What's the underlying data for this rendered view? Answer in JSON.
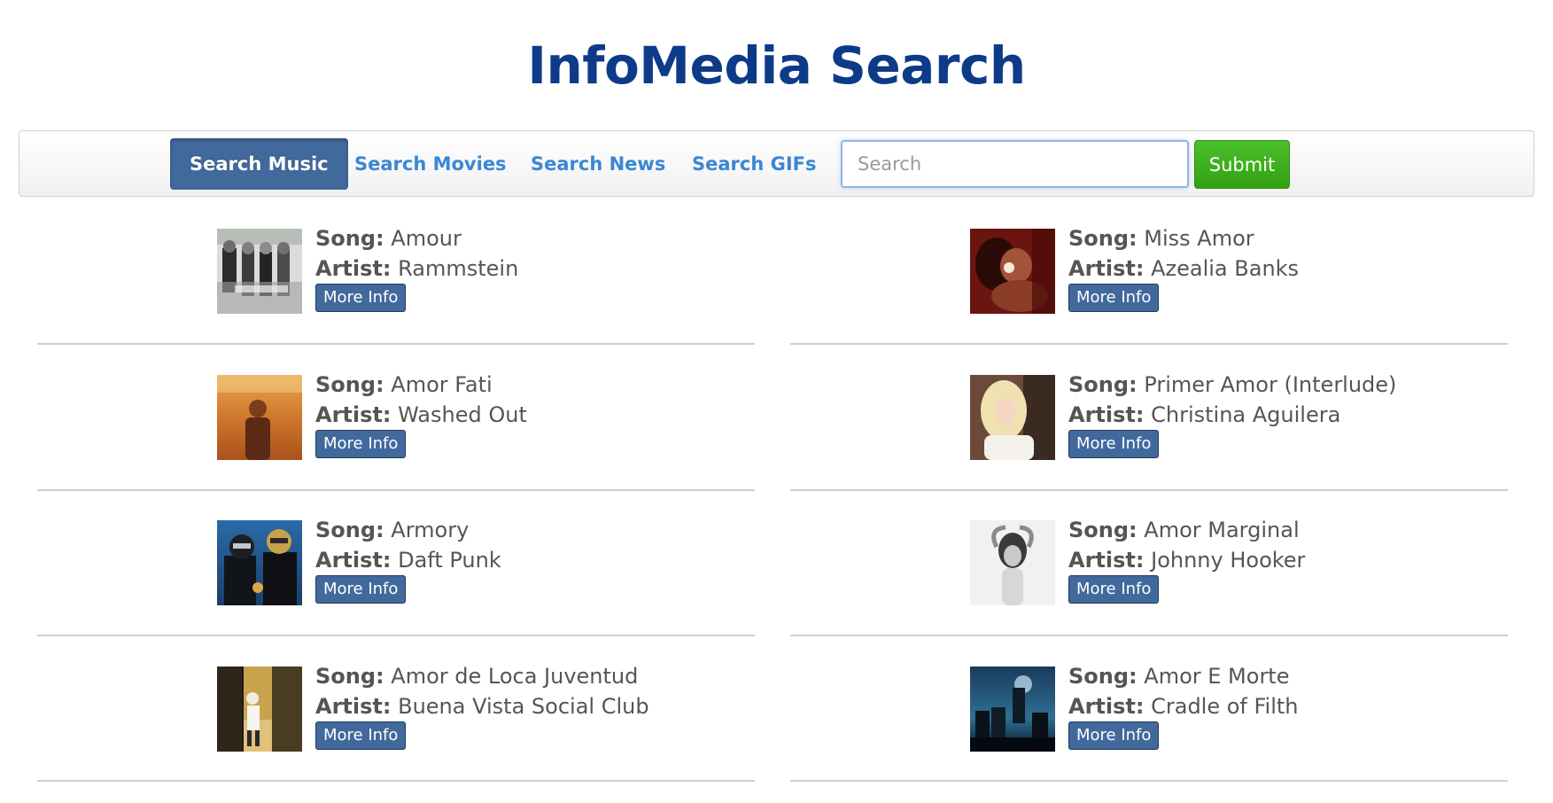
{
  "title": "InfoMedia Search",
  "nav": {
    "music": "Search Music",
    "movies": "Search Movies",
    "news": "Search News",
    "gifs": "Search GIFs"
  },
  "search": {
    "placeholder": "Search",
    "value": "",
    "submit": "Submit"
  },
  "labels": {
    "song": "Song:",
    "artist": "Artist:",
    "more_info": "More Info"
  },
  "results": [
    {
      "song": "Amour",
      "artist": "Rammstein",
      "art": "rammstein-album-art"
    },
    {
      "song": "Miss Amor",
      "artist": "Azealia Banks",
      "art": "azealia-banks-album-art"
    },
    {
      "song": "Amor Fati",
      "artist": "Washed Out",
      "art": "washed-out-album-art"
    },
    {
      "song": "Primer Amor (Interlude)",
      "artist": "Christina Aguilera",
      "art": "christina-aguilera-album-art"
    },
    {
      "song": "Armory",
      "artist": "Daft Punk",
      "art": "daft-punk-album-art"
    },
    {
      "song": "Amor Marginal",
      "artist": "Johnny Hooker",
      "art": "johnny-hooker-album-art"
    },
    {
      "song": "Amor de Loca Juventud",
      "artist": "Buena Vista Social Club",
      "art": "buena-vista-social-club-album-art"
    },
    {
      "song": "Amor E Morte",
      "artist": "Cradle of Filth",
      "art": "cradle-of-filth-album-art"
    }
  ]
}
